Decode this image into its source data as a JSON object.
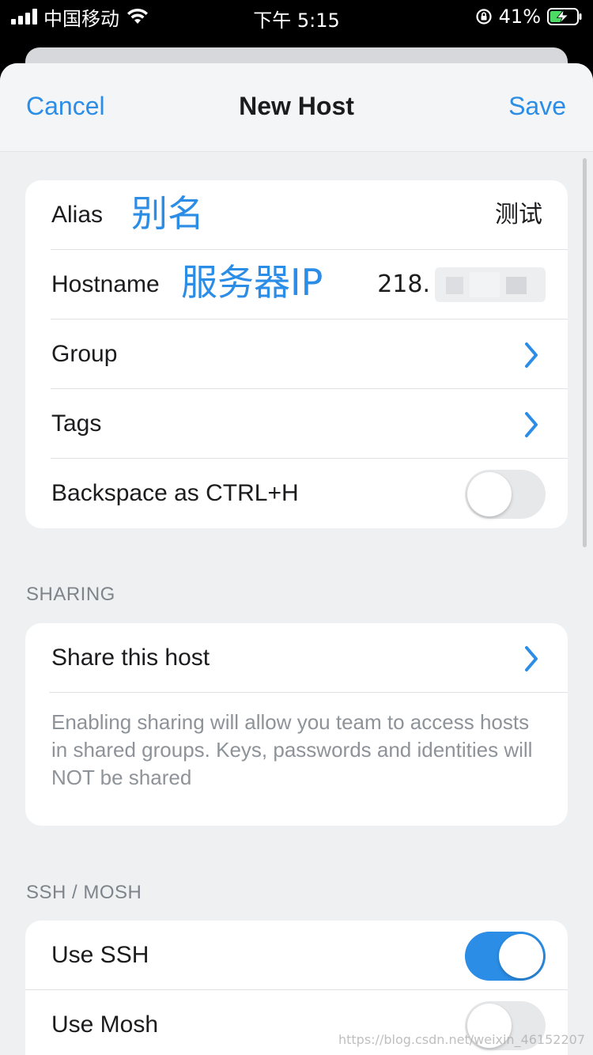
{
  "status_bar": {
    "carrier": "中国移动",
    "time": "下午 5:15",
    "battery_percent": "41%",
    "icons": [
      "signal-icon",
      "wifi-icon",
      "rotation-lock-icon",
      "battery-charging-icon"
    ]
  },
  "nav": {
    "cancel_label": "Cancel",
    "title": "New Host",
    "save_label": "Save"
  },
  "host_card": {
    "alias_label": "Alias",
    "alias_annotation": "别名",
    "alias_value": "测试",
    "hostname_label": "Hostname",
    "hostname_annotation": "服务器IP",
    "hostname_value": "218.",
    "group_label": "Group",
    "tags_label": "Tags",
    "backspace_label": "Backspace as CTRL+H",
    "backspace_enabled": false
  },
  "sharing": {
    "header": "SHARING",
    "share_label": "Share this host",
    "description": "Enabling sharing will allow you team to access hosts in shared groups. Keys, passwords and identities will NOT be shared"
  },
  "ssh_mosh": {
    "header": "SSH / MOSH",
    "use_ssh_label": "Use SSH",
    "use_ssh_enabled": true,
    "use_mosh_label": "Use Mosh",
    "use_mosh_enabled": false
  },
  "watermark": "https://blog.csdn.net/weixin_46152207",
  "colors": {
    "accent": "#2b8de5",
    "background": "#eef0f2",
    "card": "#ffffff",
    "toggle_off": "#e7e8ea"
  }
}
